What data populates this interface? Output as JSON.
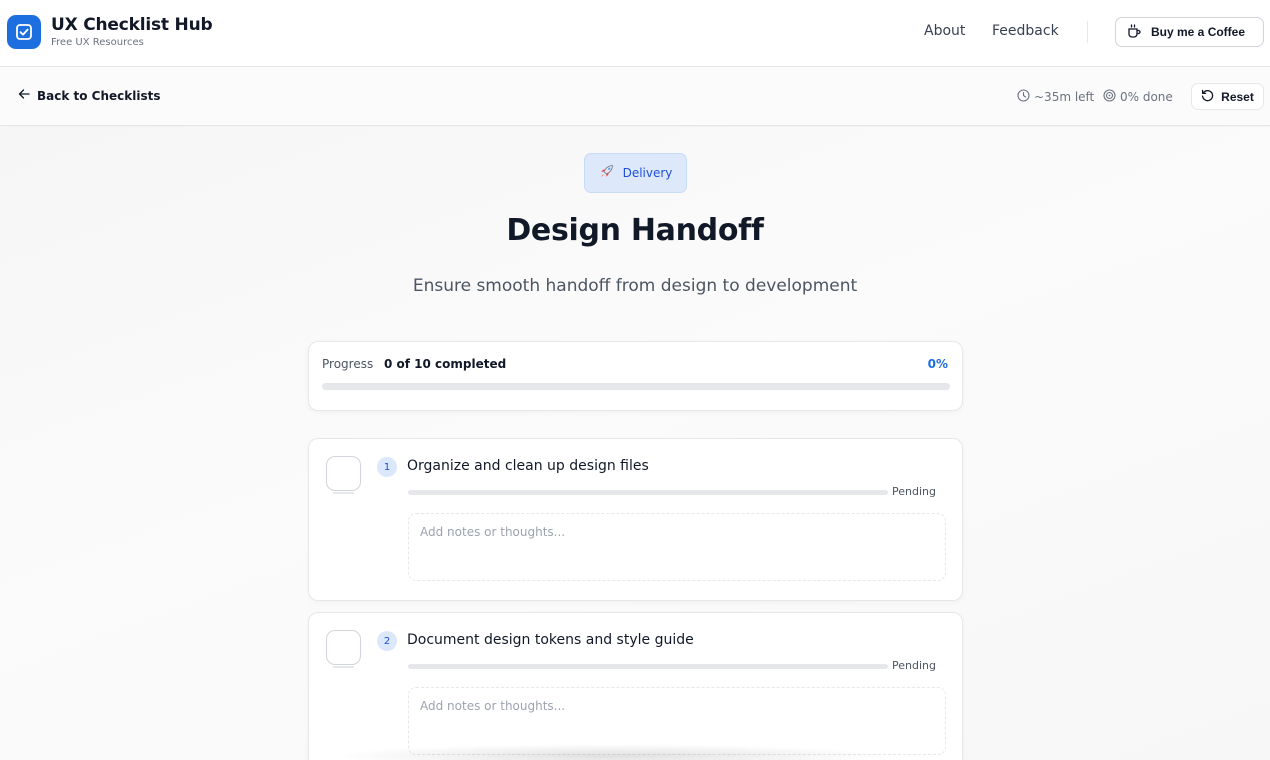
{
  "header": {
    "brand_title": "UX Checklist Hub",
    "brand_subtitle": "Free UX Resources",
    "nav": [
      {
        "label": "About"
      },
      {
        "label": "Feedback"
      }
    ],
    "coffee_label": "Buy me a Coffee",
    "accent_color": "#1d6fe0"
  },
  "subbar": {
    "back_label": "Back to Checklists",
    "time_left": "~35m left",
    "done_label": "0% done",
    "reset_label": "Reset"
  },
  "checklist": {
    "category_label": "Delivery",
    "category_icon": "rocket-icon",
    "title": "Design Handoff",
    "subtitle": "Ensure smooth handoff from design to development",
    "progress": {
      "label": "Progress",
      "count_text": "0 of 10 completed",
      "percent_text": "0%",
      "fraction": 0
    },
    "items": [
      {
        "number": "1",
        "title": "Organize and clean up design files",
        "status": "Pending",
        "progress": 0,
        "notes_placeholder": "Add notes or thoughts...",
        "checked": false
      },
      {
        "number": "2",
        "title": "Document design tokens and style guide",
        "status": "Pending",
        "progress": 0,
        "notes_placeholder": "Add notes or thoughts...",
        "checked": false
      }
    ]
  }
}
